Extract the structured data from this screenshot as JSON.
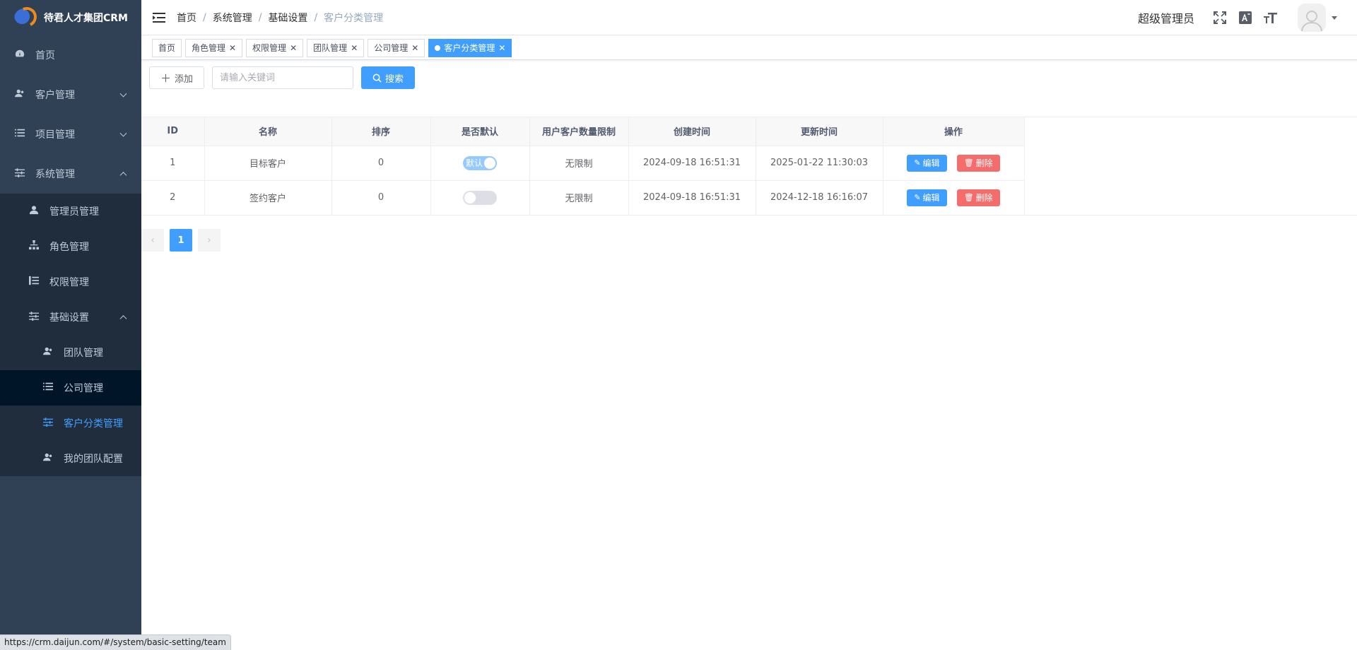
{
  "app": {
    "title": "待君人才集团CRM"
  },
  "sidebar": {
    "items": [
      {
        "label": "首页",
        "icon": "dashboard-icon"
      },
      {
        "label": "客户管理",
        "icon": "customers-icon"
      },
      {
        "label": "项目管理",
        "icon": "list-icon"
      },
      {
        "label": "系统管理",
        "icon": "sliders-icon"
      }
    ],
    "system_children": [
      {
        "label": "管理员管理",
        "icon": "user-icon"
      },
      {
        "label": "角色管理",
        "icon": "tree-icon"
      },
      {
        "label": "权限管理",
        "icon": "permission-icon"
      },
      {
        "label": "基础设置",
        "icon": "sliders-icon"
      }
    ],
    "basic_children": [
      {
        "label": "团队管理",
        "icon": "team-icon"
      },
      {
        "label": "公司管理",
        "icon": "list-icon"
      },
      {
        "label": "客户分类管理",
        "icon": "sliders-icon"
      },
      {
        "label": "我的团队配置",
        "icon": "team-icon"
      }
    ]
  },
  "header": {
    "breadcrumb": [
      "首页",
      "系统管理",
      "基础设置",
      "客户分类管理"
    ],
    "separator": "/",
    "username": "超级管理员"
  },
  "tags": [
    {
      "label": "首页",
      "closable": false
    },
    {
      "label": "角色管理",
      "closable": true
    },
    {
      "label": "权限管理",
      "closable": true
    },
    {
      "label": "团队管理",
      "closable": true
    },
    {
      "label": "公司管理",
      "closable": true
    },
    {
      "label": "客户分类管理",
      "closable": true,
      "active": true
    }
  ],
  "toolbar": {
    "add_label": "添加",
    "search_placeholder": "请输入关键词",
    "search_label": "搜索"
  },
  "table": {
    "columns": [
      "ID",
      "名称",
      "排序",
      "是否默认",
      "用户客户数量限制",
      "创建时间",
      "更新时间",
      "操作"
    ],
    "rows": [
      {
        "id": "1",
        "name": "目标客户",
        "sort": "0",
        "default": true,
        "default_text": "默认",
        "limit": "无限制",
        "created": "2024-09-18 16:51:31",
        "updated": "2025-01-22 11:30:03"
      },
      {
        "id": "2",
        "name": "签约客户",
        "sort": "0",
        "default": false,
        "default_text": "",
        "limit": "无限制",
        "created": "2024-09-18 16:51:31",
        "updated": "2024-12-18 16:16:07"
      }
    ],
    "edit_label": "编辑",
    "delete_label": "删除"
  },
  "pager": {
    "current": "1",
    "prev": "‹",
    "next": "›"
  },
  "status_url": "https://crm.daijun.com/#/system/basic-setting/team",
  "colors": {
    "sidebar_bg": "#304156",
    "primary": "#409eff",
    "danger": "#f56c6c"
  }
}
